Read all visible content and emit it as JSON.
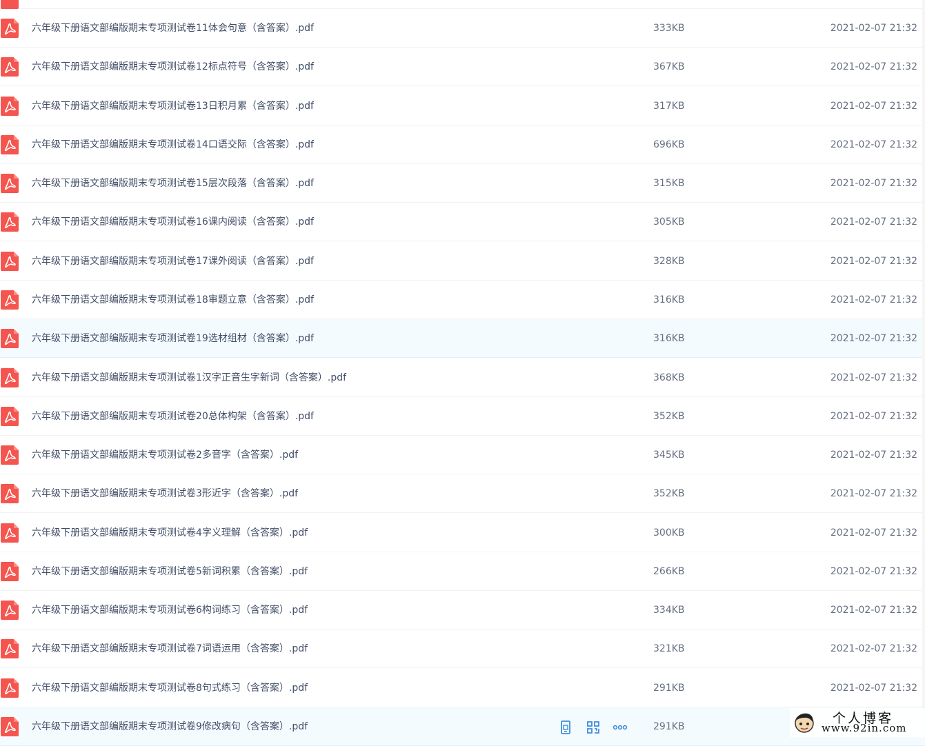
{
  "colors": {
    "pdf_icon": "#f5554f",
    "action_icon": "#3d8ddc",
    "hover_row": "#f4fbff"
  },
  "files": [
    {
      "name": "六年级下册语文部编版期末专项测试卷11体会句意（含答案）.pdf",
      "size": "333KB",
      "modified": "2021-02-07 21:32"
    },
    {
      "name": "六年级下册语文部编版期末专项测试卷12标点符号（含答案）.pdf",
      "size": "367KB",
      "modified": "2021-02-07 21:32"
    },
    {
      "name": "六年级下册语文部编版期末专项测试卷13日积月累（含答案）.pdf",
      "size": "317KB",
      "modified": "2021-02-07 21:32"
    },
    {
      "name": "六年级下册语文部编版期末专项测试卷14口语交际（含答案）.pdf",
      "size": "696KB",
      "modified": "2021-02-07 21:32"
    },
    {
      "name": "六年级下册语文部编版期末专项测试卷15层次段落（含答案）.pdf",
      "size": "315KB",
      "modified": "2021-02-07 21:32"
    },
    {
      "name": "六年级下册语文部编版期末专项测试卷16课内阅读（含答案）.pdf",
      "size": "305KB",
      "modified": "2021-02-07 21:32"
    },
    {
      "name": "六年级下册语文部编版期末专项测试卷17课外阅读（含答案）.pdf",
      "size": "328KB",
      "modified": "2021-02-07 21:32"
    },
    {
      "name": "六年级下册语文部编版期末专项测试卷18审题立意（含答案）.pdf",
      "size": "316KB",
      "modified": "2021-02-07 21:32"
    },
    {
      "name": "六年级下册语文部编版期末专项测试卷19选材组材（含答案）.pdf",
      "size": "316KB",
      "modified": "2021-02-07 21:32"
    },
    {
      "name": "六年级下册语文部编版期末专项测试卷1汉字正音生字新词（含答案）.pdf",
      "size": "368KB",
      "modified": "2021-02-07 21:32"
    },
    {
      "name": "六年级下册语文部编版期末专项测试卷20总体构架（含答案）.pdf",
      "size": "352KB",
      "modified": "2021-02-07 21:32"
    },
    {
      "name": "六年级下册语文部编版期末专项测试卷2多音字（含答案）.pdf",
      "size": "345KB",
      "modified": "2021-02-07 21:32"
    },
    {
      "name": "六年级下册语文部编版期末专项测试卷3形近字（含答案）.pdf",
      "size": "352KB",
      "modified": "2021-02-07 21:32"
    },
    {
      "name": "六年级下册语文部编版期末专项测试卷4字义理解（含答案）.pdf",
      "size": "300KB",
      "modified": "2021-02-07 21:32"
    },
    {
      "name": "六年级下册语文部编版期末专项测试卷5新词积累（含答案）.pdf",
      "size": "266KB",
      "modified": "2021-02-07 21:32"
    },
    {
      "name": "六年级下册语文部编版期末专项测试卷6构词练习（含答案）.pdf",
      "size": "334KB",
      "modified": "2021-02-07 21:32"
    },
    {
      "name": "六年级下册语文部编版期末专项测试卷7词语运用（含答案）.pdf",
      "size": "321KB",
      "modified": "2021-02-07 21:32"
    },
    {
      "name": "六年级下册语文部编版期末专项测试卷8句式练习（含答案）.pdf",
      "size": "291KB",
      "modified": "2021-02-07 21:32"
    },
    {
      "name": "六年级下册语文部编版期末专项测试卷9修改病句（含答案）.pdf",
      "size": "291KB",
      "modified": ""
    }
  ],
  "watermark": {
    "title": "个人博客",
    "url": "www.92in.com"
  }
}
